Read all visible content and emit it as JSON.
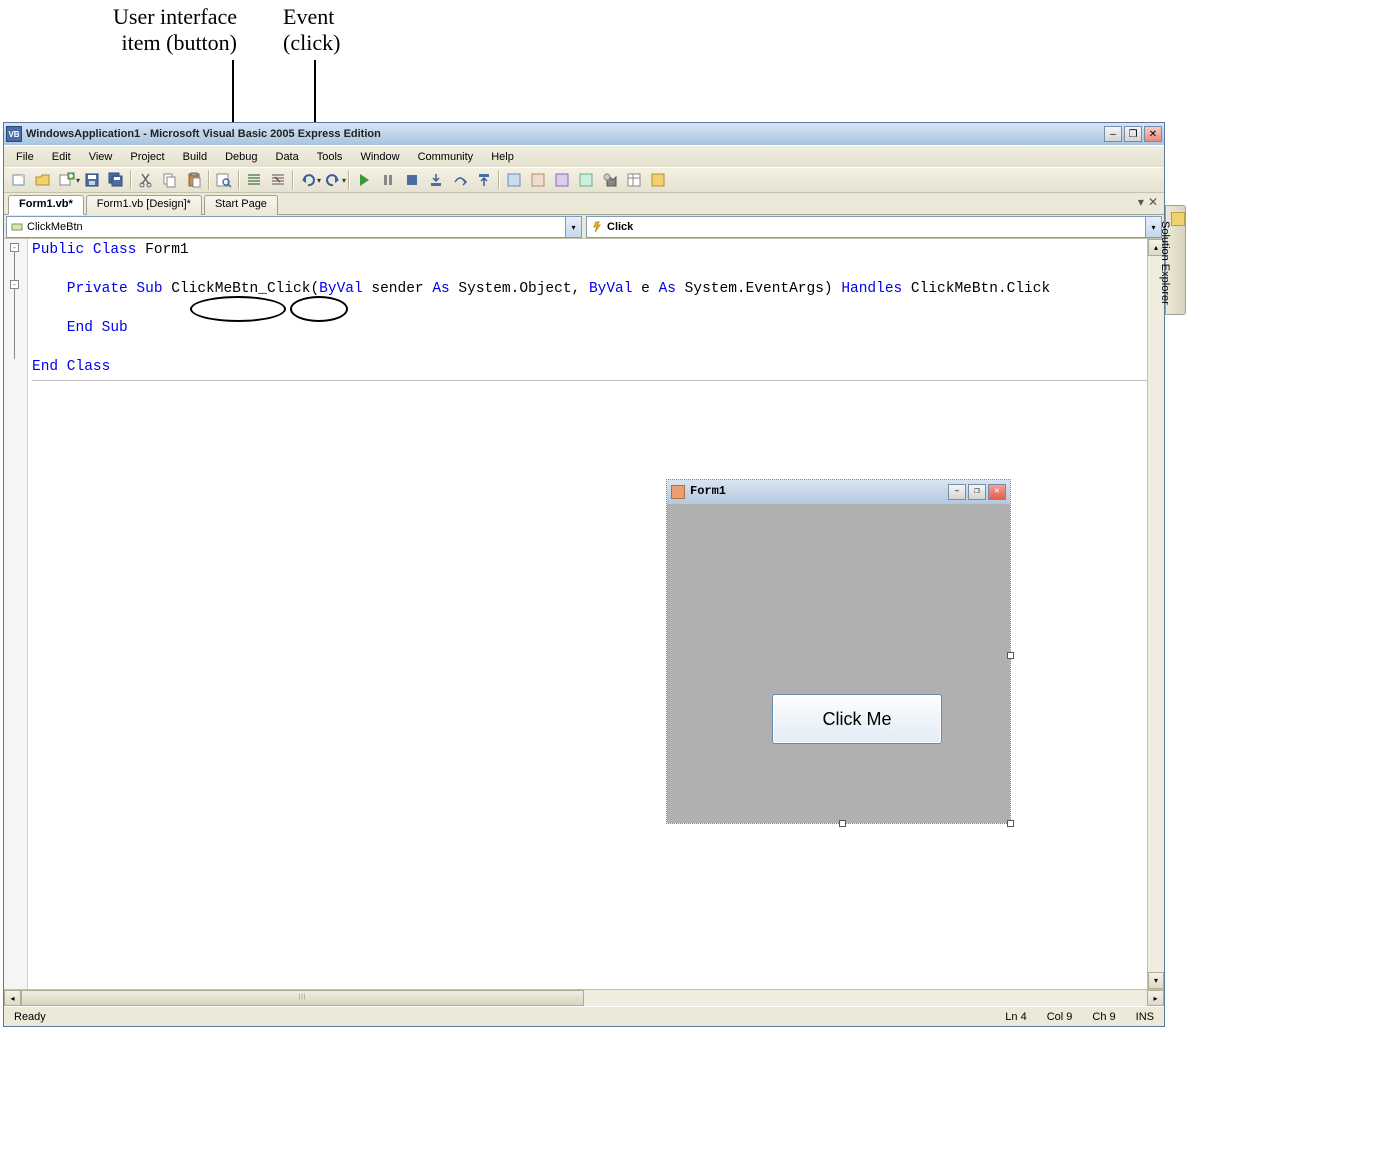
{
  "annotations": {
    "label1_line1": "User interface",
    "label1_line2": "item (button)",
    "label2_line1": "Event",
    "label2_line2": "(click)"
  },
  "window": {
    "title": "WindowsApplication1 - Microsoft Visual Basic 2005 Express Edition",
    "app_icon_text": "VB"
  },
  "menu": {
    "items": [
      "File",
      "Edit",
      "View",
      "Project",
      "Build",
      "Debug",
      "Data",
      "Tools",
      "Window",
      "Community",
      "Help"
    ]
  },
  "tabs": {
    "items": [
      {
        "label": "Form1.vb*",
        "active": true
      },
      {
        "label": "Form1.vb [Design]*",
        "active": false
      },
      {
        "label": "Start Page",
        "active": false
      }
    ]
  },
  "dropdowns": {
    "object": "ClickMeBtn",
    "event": "Click"
  },
  "code": {
    "l1a": "Public Class",
    "l1b": " Form1",
    "l2a": "    Private Sub",
    "l2b": " ClickMeBtn_Click(",
    "l2c": "ByVal",
    "l2d": " sender ",
    "l2e": "As",
    "l2f": " System.Object, ",
    "l2g": "ByVal",
    "l2h": " e ",
    "l2i": "As",
    "l2j": " System.EventArgs) ",
    "l2k": "Handles",
    "l2l": " ClickMeBtn.Click",
    "l3": "    End Sub",
    "l4": "End Class"
  },
  "designer": {
    "title": "Form1",
    "button_text": "Click Me"
  },
  "side_panel": {
    "label": "Solution Explorer"
  },
  "status": {
    "ready": "Ready",
    "ln": "Ln 4",
    "col": "Col 9",
    "ch": "Ch 9",
    "ins": "INS"
  },
  "fold": {
    "minus": "-"
  }
}
